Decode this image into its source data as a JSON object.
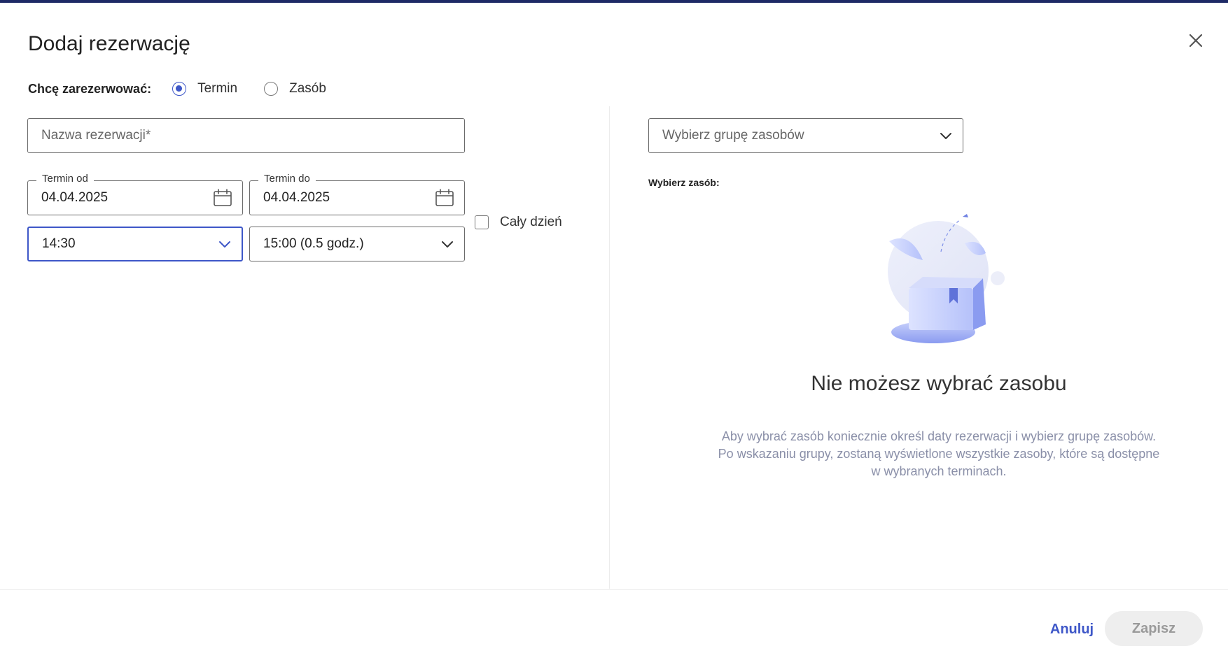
{
  "dialog": {
    "title": "Dodaj rezerwację",
    "close_icon": "close-icon"
  },
  "booking_type": {
    "label": "Chcę zarezerwować:",
    "options": [
      {
        "label": "Termin",
        "selected": true
      },
      {
        "label": "Zasób",
        "selected": false
      }
    ]
  },
  "form": {
    "name_placeholder": "Nazwa rezerwacji*",
    "date_from": {
      "legend": "Termin od",
      "value": "04.04.2025",
      "icon": "calendar-icon"
    },
    "date_to": {
      "legend": "Termin do",
      "value": "04.04.2025",
      "icon": "calendar-icon"
    },
    "time_from": {
      "value": "14:30",
      "icon": "chevron-down-icon"
    },
    "time_to": {
      "value": "15:00 (0.5 godz.)",
      "icon": "chevron-down-icon"
    },
    "all_day": {
      "label": "Cały dzień",
      "checked": false
    }
  },
  "resources": {
    "group_select_placeholder": "Wybierz grupę zasobów",
    "select_label": "Wybierz zasób:",
    "empty_title": "Nie możesz wybrać zasobu",
    "empty_desc_lines": [
      "Aby wybrać zasób koniecznie określ daty rezerwacji i wybierz grupę zasobów.",
      "Po wskazaniu grupy, zostaną wyświetlone wszystkie zasoby, które są dostępne",
      "w wybranych terminach."
    ]
  },
  "footer": {
    "cancel_label": "Anuluj",
    "save_label": "Zapisz"
  },
  "colors": {
    "accent": "#3e57c8",
    "topbar": "#1e2a66",
    "muted_text": "#8a8fa8",
    "disabled_bg": "#eeeeee"
  }
}
